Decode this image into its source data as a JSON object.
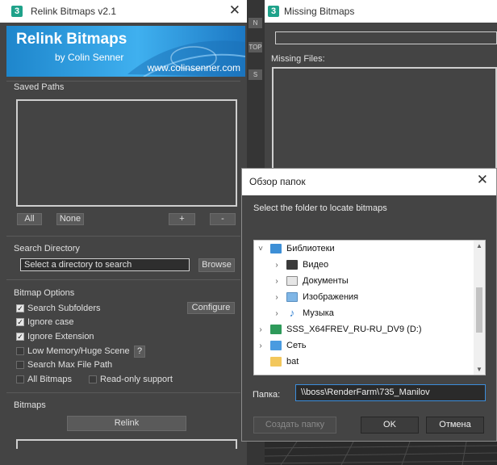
{
  "relink_window": {
    "app_icon": "3",
    "title": "Relink Bitmaps v2.1",
    "close_label": "✕",
    "banner": {
      "title": "Relink Bitmaps",
      "byline": "by Colin Senner",
      "url": "www.colinsenner.com",
      "colors": {
        "light": "#3fb0ef",
        "dark": "#1c78c4"
      }
    },
    "saved_paths": {
      "label": "Saved Paths",
      "buttons": {
        "all": "All",
        "none": "None",
        "add": "+",
        "remove": "-"
      }
    },
    "search_directory": {
      "label": "Search Directory",
      "value": "Select a directory to search",
      "browse": "Browse"
    },
    "bitmap_options": {
      "label": "Bitmap Options",
      "configure": "Configure",
      "options": [
        {
          "label": "Search Subfolders",
          "checked": true
        },
        {
          "label": "Ignore case",
          "checked": true
        },
        {
          "label": "Ignore Extension",
          "checked": true
        },
        {
          "label": "Low Memory/Huge Scene",
          "checked": false
        },
        {
          "label": "Search Max File Path",
          "checked": false
        },
        {
          "label": "All Bitmaps",
          "checked": false
        }
      ],
      "help": "?",
      "readonly": {
        "label": "Read-only support",
        "checked": false
      }
    },
    "bitmaps": {
      "label": "Bitmaps",
      "relink": "Relink"
    }
  },
  "strip": {
    "tabs": [
      "N",
      "TOP",
      "S"
    ]
  },
  "missing_window": {
    "app_icon": "3",
    "title": "Missing Bitmaps",
    "missing_files_label": "Missing Files:"
  },
  "dialog": {
    "title": "Обзор папок",
    "close_label": "✕",
    "instruction": "Select the folder to locate bitmaps",
    "tree": [
      {
        "label": "Библиотеки",
        "expanded": true,
        "level": 0,
        "icon": "library-icon"
      },
      {
        "label": "Видео",
        "expanded": false,
        "level": 1,
        "icon": "video-folder-icon"
      },
      {
        "label": "Документы",
        "expanded": false,
        "level": 1,
        "icon": "documents-folder-icon"
      },
      {
        "label": "Изображения",
        "expanded": false,
        "level": 1,
        "icon": "images-folder-icon"
      },
      {
        "label": "Музыка",
        "expanded": false,
        "level": 1,
        "icon": "music-folder-icon"
      },
      {
        "label": "SSS_X64FREV_RU-RU_DV9 (D:)",
        "expanded": false,
        "level": 0,
        "icon": "dvd-drive-icon"
      },
      {
        "label": "Сеть",
        "expanded": false,
        "level": 0,
        "icon": "network-icon"
      },
      {
        "label": "bat",
        "expanded": null,
        "level": 0,
        "icon": "folder-icon"
      }
    ],
    "folder_label": "Папка:",
    "folder_value": "\\\\boss\\RenderFarm\\735_Manilov",
    "buttons": {
      "new_folder": "Создать папку",
      "ok": "OK",
      "cancel": "Отмена"
    }
  }
}
